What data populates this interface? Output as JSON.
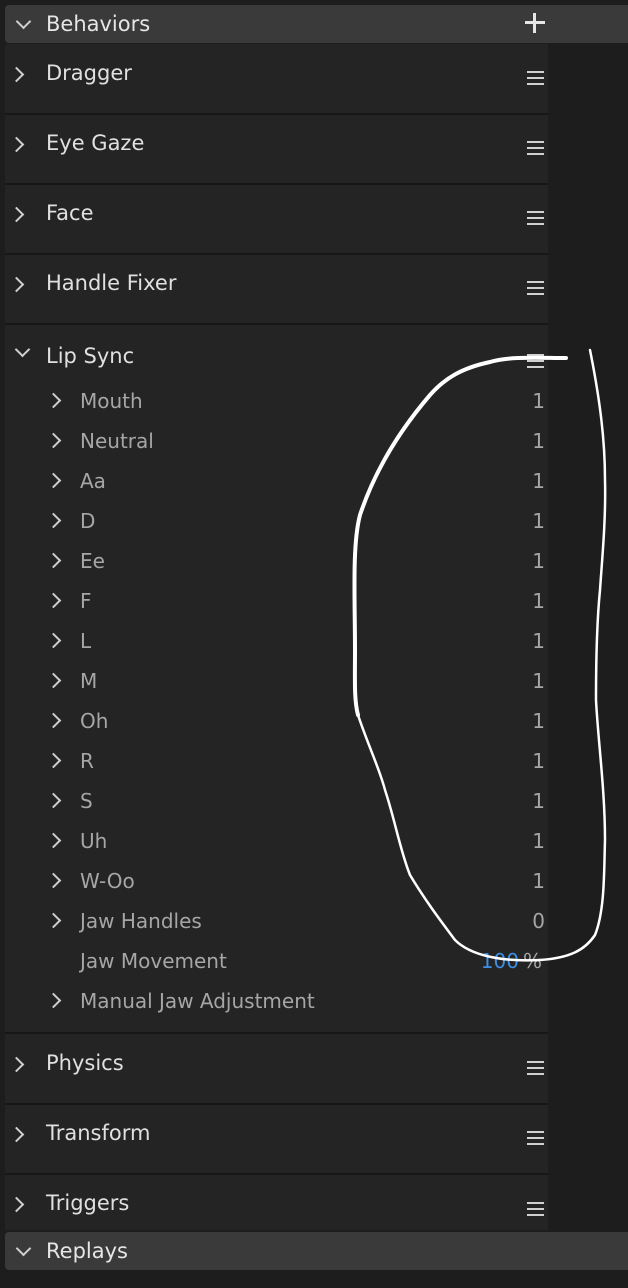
{
  "behaviors": {
    "title": "Behaviors",
    "items": [
      {
        "label": "Dragger"
      },
      {
        "label": "Eye Gaze"
      },
      {
        "label": "Face"
      },
      {
        "label": "Handle Fixer"
      }
    ],
    "lip_sync": {
      "label": "Lip Sync",
      "children": [
        {
          "label": "Mouth",
          "count": "1"
        },
        {
          "label": "Neutral",
          "count": "1"
        },
        {
          "label": "Aa",
          "count": "1"
        },
        {
          "label": "D",
          "count": "1"
        },
        {
          "label": "Ee",
          "count": "1"
        },
        {
          "label": "F",
          "count": "1"
        },
        {
          "label": "L",
          "count": "1"
        },
        {
          "label": "M",
          "count": "1"
        },
        {
          "label": "Oh",
          "count": "1"
        },
        {
          "label": "R",
          "count": "1"
        },
        {
          "label": "S",
          "count": "1"
        },
        {
          "label": "Uh",
          "count": "1"
        },
        {
          "label": "W-Oo",
          "count": "1"
        },
        {
          "label": "Jaw Handles",
          "count": "0"
        }
      ],
      "jaw_movement": {
        "label": "Jaw Movement",
        "value": "100",
        "unit": "%"
      },
      "manual_jaw": {
        "label": "Manual Jaw Adjustment"
      }
    },
    "items_after": [
      {
        "label": "Physics"
      },
      {
        "label": "Transform"
      },
      {
        "label": "Triggers"
      }
    ]
  },
  "replays": {
    "title": "Replays"
  },
  "colors": {
    "panel_bg": "#242424",
    "header_bg": "#3a3a3a",
    "accent": "#3d8fe6",
    "annotation": "#ffffff"
  },
  "icons": {
    "section_toggle": "chevron-down-icon",
    "add": "plus-icon",
    "row_toggle": "chevron-right-icon",
    "row_menu": "menu-icon"
  }
}
